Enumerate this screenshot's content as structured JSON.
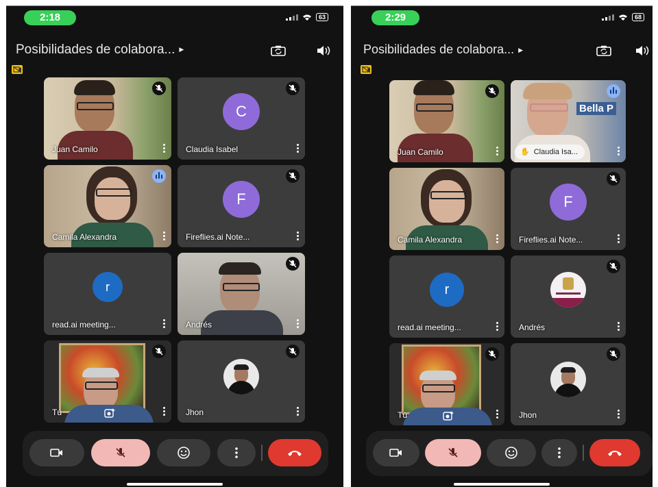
{
  "left_phone": {
    "time": "2:18",
    "battery": "63",
    "meeting_title": "Posibilidades de colabora...",
    "participants": [
      {
        "name": "Juan Camilo",
        "type": "video",
        "muted": true
      },
      {
        "name": "Claudia Isabel",
        "type": "avatar",
        "initial": "C",
        "avatar_color": "#8e6bd8",
        "muted": true
      },
      {
        "name": "Camila Alexandra",
        "type": "video",
        "speaking": true
      },
      {
        "name": "Fireflies.ai Note...",
        "type": "avatar",
        "initial": "F",
        "avatar_color": "#8e6bd8",
        "muted": true
      },
      {
        "name": "read.ai meeting...",
        "type": "avatar",
        "initial": "r",
        "avatar_color": "#1e6bc4"
      },
      {
        "name": "Andrés",
        "type": "video",
        "muted": true
      },
      {
        "name": "Tú",
        "type": "video",
        "muted": true
      },
      {
        "name": "Jhon",
        "type": "photo-avatar",
        "muted": true
      }
    ]
  },
  "right_phone": {
    "time": "2:29",
    "battery": "68",
    "meeting_title": "Posibilidades de colabora...",
    "participants": [
      {
        "name": "Juan Camilo",
        "type": "video",
        "muted": true
      },
      {
        "name": "Claudia Isa...",
        "type": "video",
        "speaking": true,
        "hand_raised": true,
        "background_text": "Bella P"
      },
      {
        "name": "Camila Alexandra",
        "type": "video"
      },
      {
        "name": "Fireflies.ai Note...",
        "type": "avatar",
        "initial": "F",
        "avatar_color": "#8e6bd8",
        "muted": true
      },
      {
        "name": "read.ai meeting...",
        "type": "avatar",
        "initial": "r",
        "avatar_color": "#1e6bc4"
      },
      {
        "name": "Andrés",
        "type": "logo-avatar",
        "muted": true
      },
      {
        "name": "Tú",
        "type": "video",
        "muted": true
      },
      {
        "name": "Jhon",
        "type": "photo-avatar",
        "muted": true
      }
    ]
  },
  "controls": {
    "icons": [
      "camera-icon",
      "mic-off-icon",
      "emoji-icon",
      "more-vert-icon",
      "hang-up-icon"
    ],
    "mic_active_color": "#f2b8b5",
    "hangup_color": "#e0392f"
  }
}
